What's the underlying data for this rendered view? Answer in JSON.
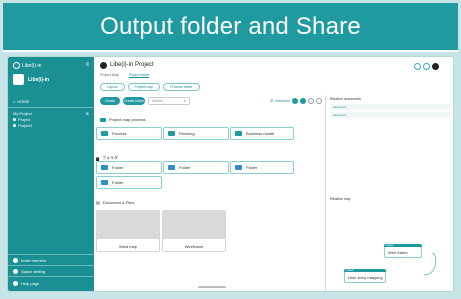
{
  "banner": {
    "title": "Output folder and Share"
  },
  "sidebar": {
    "logo": "Libe(i)-in",
    "project_name": "Libe(i)-in",
    "home": "HOME",
    "my_project": "My Project",
    "items": [
      {
        "label": "Project"
      },
      {
        "label": "Project1"
      }
    ],
    "bottom": [
      {
        "label": "Invite member"
      },
      {
        "label": "Space setting"
      },
      {
        "label": "Help page"
      }
    ]
  },
  "header": {
    "title": "Libe(i)-in Project",
    "breadcrumb": [
      "Project Map",
      "Project folder"
    ],
    "subtabs": [
      "Layout",
      "Project map",
      "Process folder"
    ]
  },
  "toolbar": {
    "create": "Create",
    "create_folder": "Create folder",
    "search_placeholder": "Search",
    "right_label": "members"
  },
  "main": {
    "process_title": "Project map process",
    "process_cards": [
      "Process",
      "Planning",
      "Business model"
    ],
    "folder_title": "フォルダ",
    "folder_cards": [
      "Folder",
      "Folder",
      "Folder",
      "Folder"
    ],
    "docs_title": "Document & Files",
    "docs": [
      "Wind map",
      "Wireframe"
    ]
  },
  "right_panel": {
    "docs_title": "Relation documents",
    "docs": [
      "document",
      "document"
    ],
    "map_title": "Relation map",
    "nodes": [
      {
        "cap": "Linked",
        "label": "Wire frame"
      },
      {
        "cap": "Linked",
        "label": "User story mapping"
      }
    ]
  }
}
